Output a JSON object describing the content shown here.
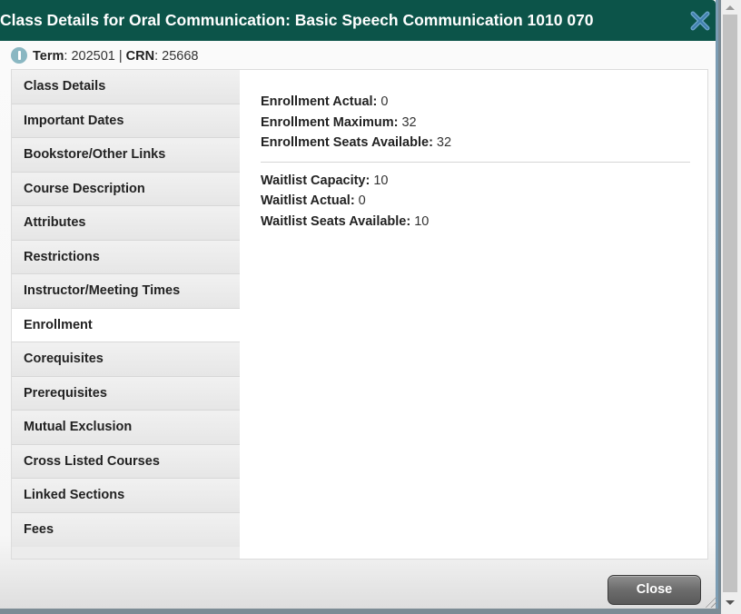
{
  "dialog": {
    "title": "Class Details for Oral Communication: Basic Speech Communication 1010 070",
    "close_icon": "close-x-icon"
  },
  "info": {
    "icon": "info-icon",
    "term_label": "Term",
    "term_value": ": 202501 | ",
    "crn_label": "CRN",
    "crn_value": ": 25668"
  },
  "nav": {
    "items": [
      {
        "label": "Class Details"
      },
      {
        "label": "Important Dates"
      },
      {
        "label": "Bookstore/Other Links"
      },
      {
        "label": "Course Description"
      },
      {
        "label": "Attributes"
      },
      {
        "label": "Restrictions"
      },
      {
        "label": "Instructor/Meeting Times"
      },
      {
        "label": "Enrollment"
      },
      {
        "label": "Corequisites"
      },
      {
        "label": "Prerequisites"
      },
      {
        "label": "Mutual Exclusion"
      },
      {
        "label": "Cross Listed Courses"
      },
      {
        "label": "Linked Sections"
      },
      {
        "label": "Fees"
      }
    ],
    "active": "Enrollment"
  },
  "enrollment": {
    "enrollment_rows": [
      {
        "label": "Enrollment Actual:",
        "value": " 0"
      },
      {
        "label": "Enrollment Maximum:",
        "value": " 32"
      },
      {
        "label": "Enrollment Seats Available:",
        "value": " 32"
      }
    ],
    "waitlist_rows": [
      {
        "label": "Waitlist Capacity:",
        "value": " 10"
      },
      {
        "label": "Waitlist Actual:",
        "value": " 0"
      },
      {
        "label": "Waitlist Seats Available:",
        "value": " 10"
      }
    ]
  },
  "footer": {
    "close_label": "Close"
  }
}
